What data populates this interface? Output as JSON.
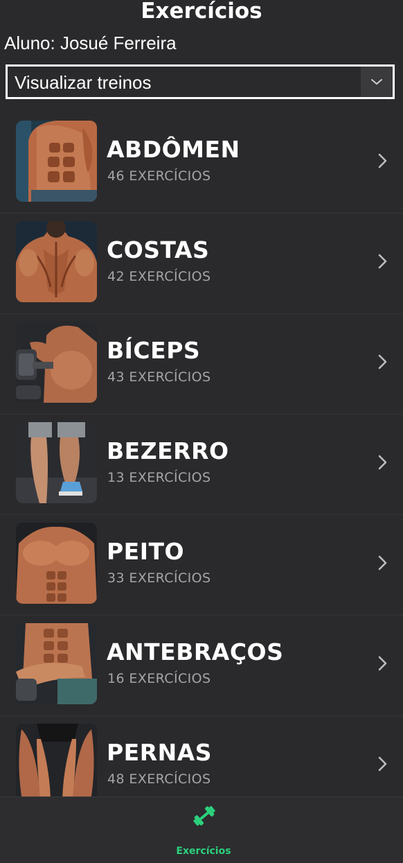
{
  "header": {
    "title": "Exercícios",
    "student_label": "Aluno: Josué Ferreira"
  },
  "workout_select": {
    "selected_value": "Visualizar treinos"
  },
  "categories": [
    {
      "name": "ABDÔMEN",
      "count": "46 EXERCÍCIOS"
    },
    {
      "name": "COSTAS",
      "count": "42 EXERCÍCIOS"
    },
    {
      "name": "BÍCEPS",
      "count": "43 EXERCÍCIOS"
    },
    {
      "name": "BEZERRO",
      "count": "13 EXERCÍCIOS"
    },
    {
      "name": "PEITO",
      "count": "33 EXERCÍCIOS"
    },
    {
      "name": "ANTEBRAÇOS",
      "count": "16 EXERCÍCIOS"
    },
    {
      "name": "PERNAS",
      "count": "48 EXERCÍCIOS"
    }
  ],
  "bottom_nav": {
    "tabs": [
      {
        "label": "Exercícios",
        "icon": "dumbbell-icon",
        "active": true
      }
    ]
  },
  "colors": {
    "background": "#2a2a2c",
    "accent": "#2bd17c",
    "subtext": "#a5a5a8"
  }
}
